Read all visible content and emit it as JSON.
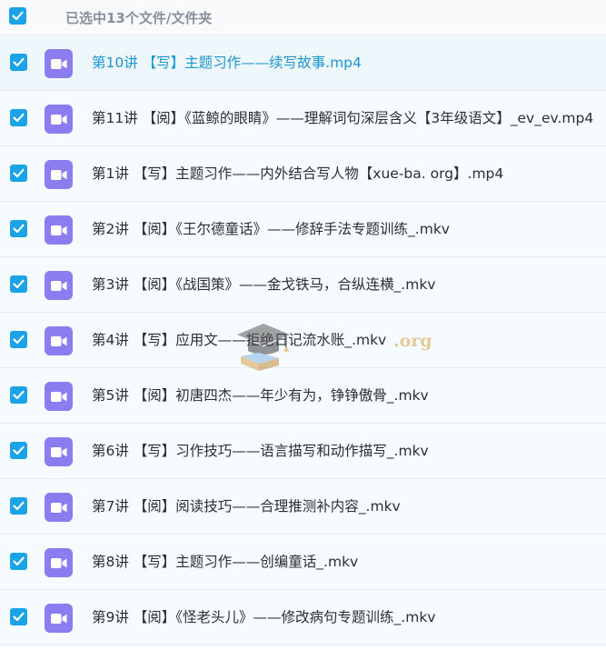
{
  "header": {
    "selection_label": "已选中13个文件/文件夹",
    "select_all_checked": true
  },
  "colors": {
    "checkbox": "#1aa3e6",
    "video_icon": "#8b7cf0",
    "highlight_text": "#1b96d1",
    "row_background": "#f5fbfe"
  },
  "icons": {
    "checkbox": "checkmark-icon",
    "file": "video-camera-icon"
  },
  "files": [
    {
      "name": "第10讲 【写】主题习作——续写故事.mp4",
      "checked": true,
      "highlighted": true
    },
    {
      "name": "第11讲 【阅】《蓝鲸的眼睛》——理解词句深层含义【3年级语文】_ev_ev.mp4",
      "checked": true,
      "highlighted": false
    },
    {
      "name": "第1讲 【写】主题习作——内外结合写人物【xue-ba. org】.mp4",
      "checked": true,
      "highlighted": false
    },
    {
      "name": "第2讲 【阅】《王尔德童话》——修辞手法专题训练_.mkv",
      "checked": true,
      "highlighted": false
    },
    {
      "name": "第3讲 【阅】《战国策》——金戈铁马，合纵连横_.mkv",
      "checked": true,
      "highlighted": false
    },
    {
      "name": "第4讲 【写】应用文——拒绝日记流水账_.mkv",
      "checked": true,
      "highlighted": false
    },
    {
      "name": "第5讲 【阅】初唐四杰——年少有为，铮铮傲骨_.mkv",
      "checked": true,
      "highlighted": false
    },
    {
      "name": "第6讲 【写】习作技巧——语言描写和动作描写_.mkv",
      "checked": true,
      "highlighted": false
    },
    {
      "name": "第7讲 【阅】阅读技巧——合理推测补内容_.mkv",
      "checked": true,
      "highlighted": false
    },
    {
      "name": "第8讲 【写】主题习作——创编童话_.mkv",
      "checked": true,
      "highlighted": false
    },
    {
      "name": "第9讲 【阅】《怪老头儿》——修改病句专题训练_.mkv",
      "checked": true,
      "highlighted": false
    }
  ]
}
